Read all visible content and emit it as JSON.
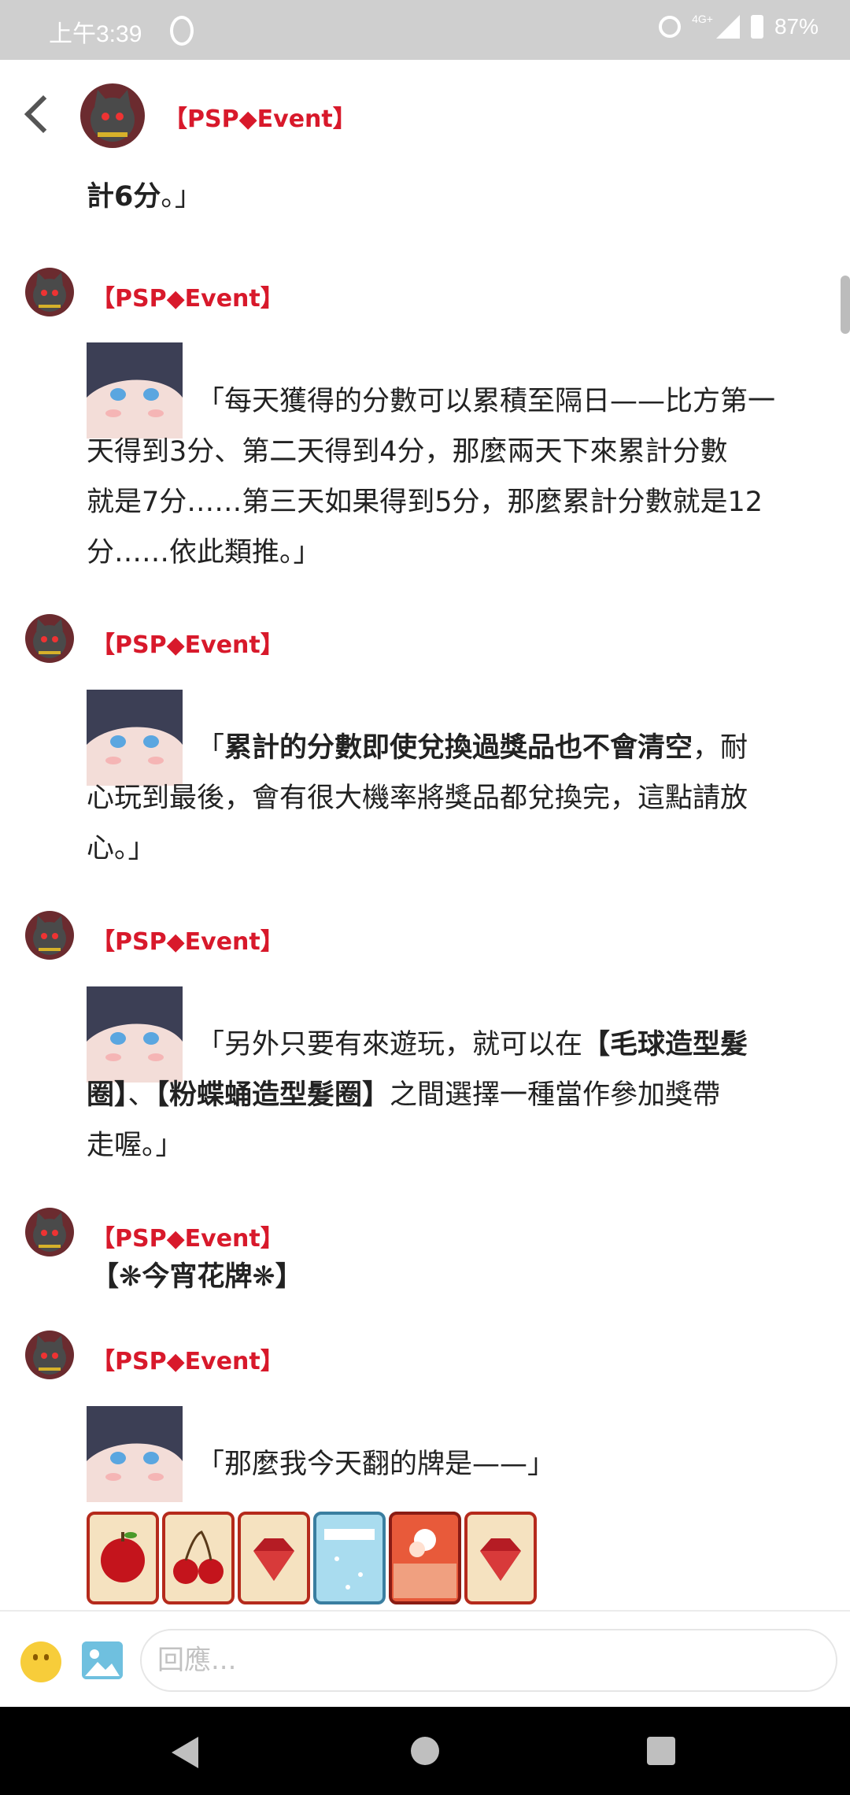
{
  "status_bar": {
    "time": "上午3:39",
    "network": "4G+",
    "battery": "87%"
  },
  "header": {
    "title": "【PSP◆Event】"
  },
  "messages": [
    {
      "partial_text_1": "計6分",
      "partial_text_2": "。」"
    },
    {
      "sender": "【PSP◆Event】",
      "lines": [
        "「每天獲得的分數可以累積至隔日——比方第一",
        "天得到3分、第二天得到4分，那麼兩天下來累計分數",
        "就是7分……第三天如果得到5分，那麼累計分數就是12",
        "分……依此類推。」"
      ]
    },
    {
      "sender": "【PSP◆Event】",
      "text_1": "「",
      "bold_1": "累計的分數即使兌換過獎品也不會清空",
      "text_2": "，耐",
      "line_2": "心玩到最後，會有很大機率將獎品都兌換完，這點請放",
      "line_3": "心。」"
    },
    {
      "sender": "【PSP◆Event】",
      "text_1": "「另外只要有來遊玩，就可以在",
      "bold_1": "【毛球造型髮",
      "bold_2": "圈】",
      "text_2": "、",
      "bold_3": "【粉蝶蛹造型髮圈】",
      "text_3": "之間選擇一種當作參加獎帶",
      "line_3": "走喔。」"
    },
    {
      "sender": "【PSP◆Event】",
      "text": "【❋今宵花牌❋】"
    },
    {
      "sender": "【PSP◆Event】",
      "text": "「那麼我今天翻的牌是——」",
      "cards": [
        "apple",
        "cherry",
        "gem",
        "ice",
        "fire",
        "gem"
      ]
    }
  ],
  "input": {
    "placeholder": "回應..."
  },
  "colors": {
    "accent_red": "#d8192b",
    "status_bar": "#cfcfcf",
    "nav_bar": "#000000"
  },
  "icons": [
    "back-arrow-icon",
    "emoji-icon",
    "image-icon",
    "nav-back-icon",
    "nav-home-icon",
    "nav-recent-icon"
  ]
}
